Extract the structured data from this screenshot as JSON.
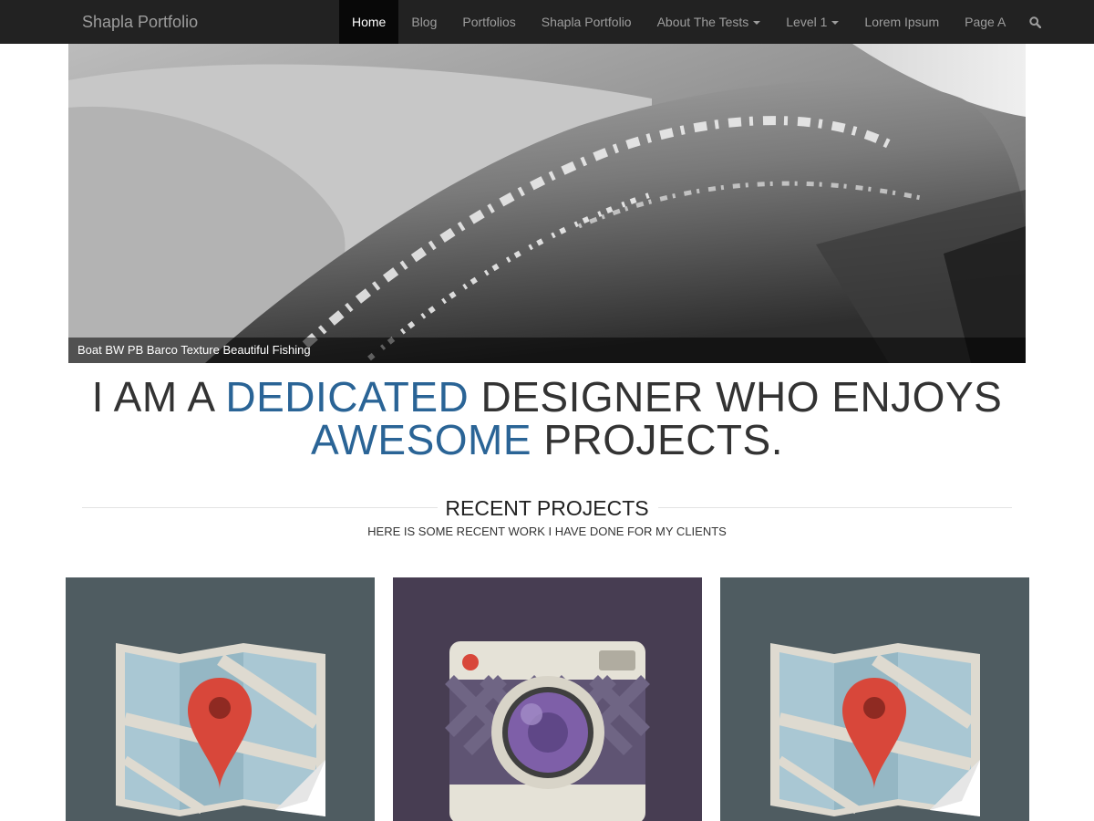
{
  "nav": {
    "brand": "Shapla Portfolio",
    "items": [
      {
        "label": "Home",
        "active": true,
        "dropdown": false
      },
      {
        "label": "Blog",
        "active": false,
        "dropdown": false
      },
      {
        "label": "Portfolios",
        "active": false,
        "dropdown": false
      },
      {
        "label": "Shapla Portfolio",
        "active": false,
        "dropdown": false
      },
      {
        "label": "About The Tests",
        "active": false,
        "dropdown": true
      },
      {
        "label": "Level 1",
        "active": false,
        "dropdown": true
      },
      {
        "label": "Lorem Ipsum",
        "active": false,
        "dropdown": false
      },
      {
        "label": "Page A",
        "active": false,
        "dropdown": false
      }
    ],
    "search_icon": "search-icon"
  },
  "slider": {
    "caption": "Boat BW PB Barco Texture Beautiful Fishing"
  },
  "tagline": {
    "line1_a": "I AM A ",
    "line1_hl": "DEDICATED",
    "line1_b": " DESIGNER WHO ENJOYS",
    "line2_hl": "AWESOME",
    "line2_b": " PROJECTS."
  },
  "section": {
    "title": "RECENT PROJECTS",
    "subtitle": "HERE IS SOME RECENT WORK I HAVE DONE FOR MY CLIENTS"
  },
  "projects": [
    {
      "icon": "map-icon",
      "background": "#4f5c61"
    },
    {
      "icon": "camera-icon",
      "background": "#473d52"
    },
    {
      "icon": "map-icon",
      "background": "#4f5c61"
    }
  ],
  "colors": {
    "navbar": "#222222",
    "accent": "#2a6496",
    "text": "#333333"
  }
}
